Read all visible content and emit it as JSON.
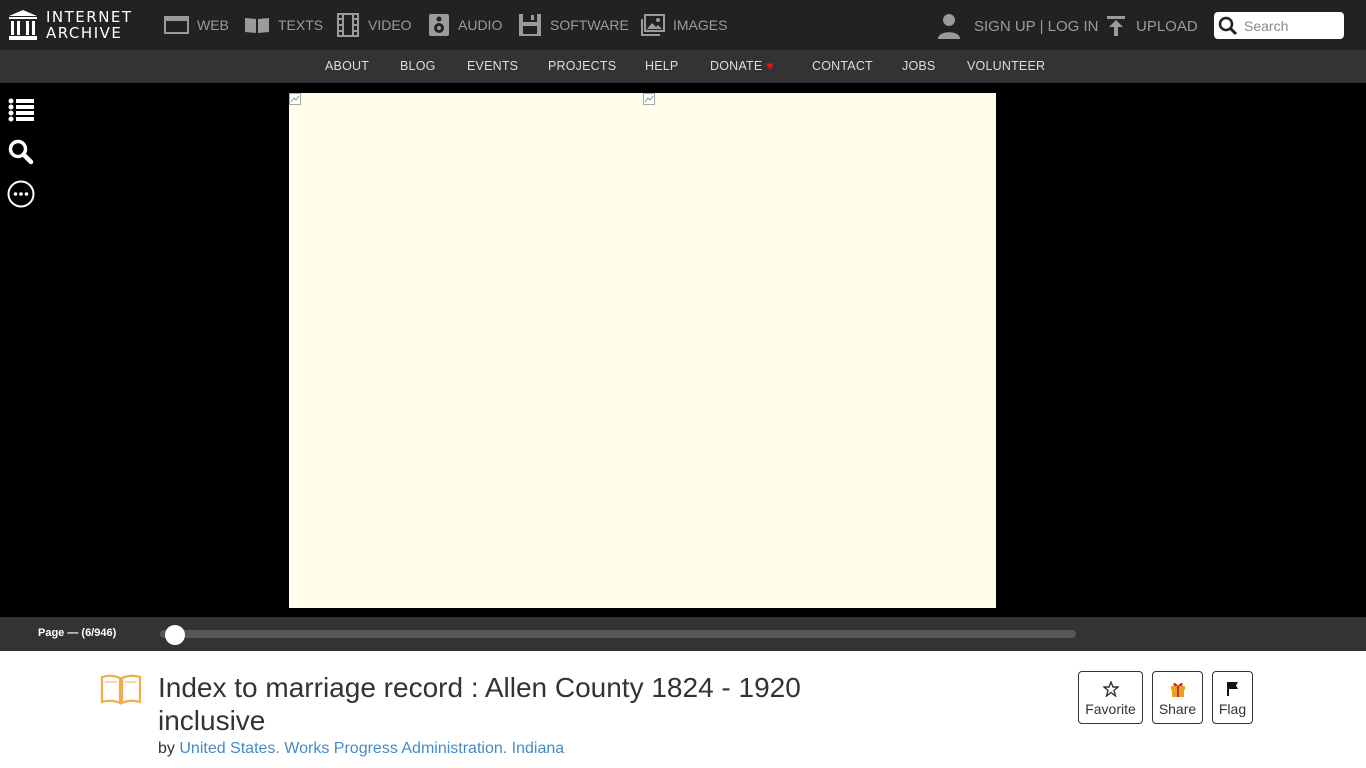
{
  "header": {
    "logo_line1": "INTERNET",
    "logo_line2": "ARCHIVE",
    "nav": {
      "web": "WEB",
      "texts": "TEXTS",
      "video": "VIDEO",
      "audio": "AUDIO",
      "software": "SOFTWARE",
      "images": "IMAGES"
    },
    "signup_login": "SIGN UP | LOG IN",
    "upload": "UPLOAD",
    "search_placeholder": "Search"
  },
  "subnav": {
    "about": "ABOUT",
    "blog": "BLOG",
    "events": "EVENTS",
    "projects": "PROJECTS",
    "help": "HELP",
    "donate": "DONATE",
    "contact": "CONTACT",
    "jobs": "JOBS",
    "volunteer": "VOLUNTEER"
  },
  "viewer": {
    "sidebar_icons": [
      "list-icon",
      "search-icon",
      "more-icon"
    ],
    "page_label": "Page — (6/946)",
    "progress": 0.0053
  },
  "item": {
    "title": "Index to marriage record : Allen County 1824 - 1920 inclusive",
    "by_prefix": "by",
    "author": "United States. Works Progress Administration. Indiana",
    "actions": {
      "favorite": "Favorite",
      "share": "Share",
      "flag": "Flag"
    }
  },
  "colors": {
    "topbar": "#222222",
    "subnav": "#333333",
    "viewer_bg": "#000000",
    "page_bg": "#fffeea",
    "link": "#428bca",
    "donate_heart": "#ee1111",
    "book_icon": "#f0ad4e"
  }
}
